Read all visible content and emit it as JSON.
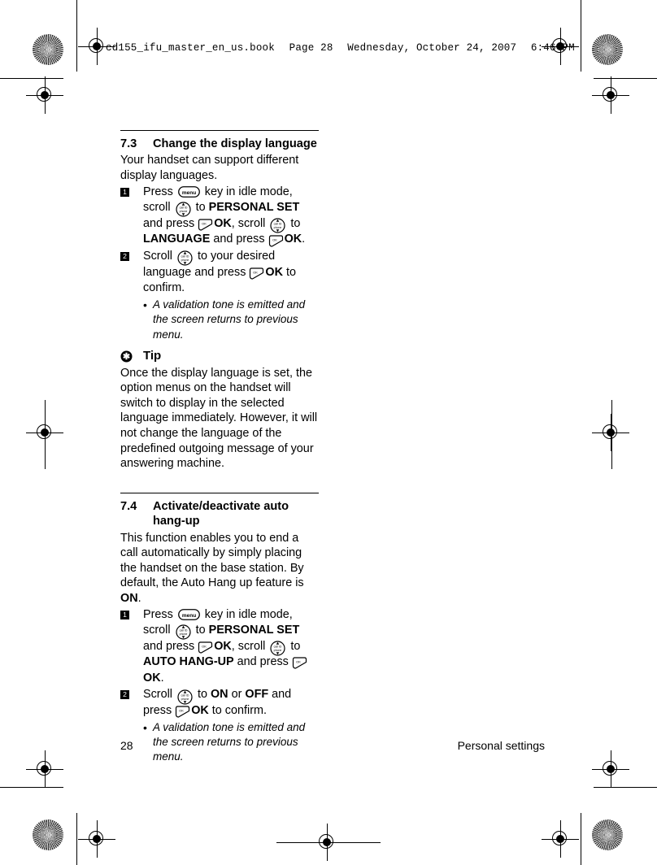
{
  "page": {
    "book_header": {
      "filename": "cd155_ifu_master_en_us.book",
      "page_label": "Page 28",
      "date": "Wednesday, October 24, 2007",
      "time": "6:46 PM"
    },
    "footer": {
      "page_number": "28",
      "chapter": "Personal settings"
    }
  },
  "sections": [
    {
      "number": "7.3",
      "title": "Change the display language",
      "intro": "Your handset can support different display languages.",
      "steps": [
        {
          "marker": "1",
          "parts": [
            {
              "type": "text",
              "value": "Press "
            },
            {
              "type": "key",
              "icon": "menu-key-icon",
              "label": "menu"
            },
            {
              "type": "text",
              "value": " key in idle mode, scroll "
            },
            {
              "type": "key",
              "icon": "scroll-key-icon",
              "label": "scroll"
            },
            {
              "type": "text",
              "value": " to "
            },
            {
              "type": "bold",
              "value": "PERSONAL SET"
            },
            {
              "type": "text",
              "value": " and press "
            },
            {
              "type": "key",
              "icon": "ok-softkey-icon",
              "label": "OK"
            },
            {
              "type": "bold",
              "value": "OK"
            },
            {
              "type": "text",
              "value": ", scroll "
            },
            {
              "type": "key",
              "icon": "scroll-key-icon",
              "label": "scroll"
            },
            {
              "type": "text",
              "value": " to "
            },
            {
              "type": "bold",
              "value": "LANGUAGE"
            },
            {
              "type": "text",
              "value": " and press "
            },
            {
              "type": "key",
              "icon": "ok-softkey-icon",
              "label": "OK"
            },
            {
              "type": "bold",
              "value": "OK"
            },
            {
              "type": "text",
              "value": "."
            }
          ]
        },
        {
          "marker": "2",
          "parts": [
            {
              "type": "text",
              "value": "Scroll "
            },
            {
              "type": "key",
              "icon": "scroll-key-icon",
              "label": "scroll"
            },
            {
              "type": "text",
              "value": " to your desired language and press "
            },
            {
              "type": "key",
              "icon": "ok-softkey-icon",
              "label": "OK"
            },
            {
              "type": "bold",
              "value": "OK"
            },
            {
              "type": "text",
              "value": " to confirm."
            }
          ],
          "note": "A validation tone is emitted and the screen returns to previous menu."
        }
      ],
      "tip": {
        "label": "Tip",
        "icon": "asterisk-tip-icon",
        "text": "Once the display language is set, the option menus on the handset will switch to display in the selected language immediately. However, it will not change the language of the predefined outgoing message of your answering machine."
      }
    },
    {
      "number": "7.4",
      "title": "Activate/deactivate auto hang-up",
      "intro_parts": [
        {
          "type": "text",
          "value": "This function enables you to end a call automatically by simply placing the handset on the base station. By default, the Auto Hang up feature is "
        },
        {
          "type": "bold",
          "value": "ON"
        },
        {
          "type": "text",
          "value": "."
        }
      ],
      "steps": [
        {
          "marker": "1",
          "parts": [
            {
              "type": "text",
              "value": "Press "
            },
            {
              "type": "key",
              "icon": "menu-key-icon",
              "label": "menu"
            },
            {
              "type": "text",
              "value": " key in idle mode, scroll "
            },
            {
              "type": "key",
              "icon": "scroll-key-icon",
              "label": "scroll"
            },
            {
              "type": "text",
              "value": " to "
            },
            {
              "type": "bold",
              "value": "PERSONAL SET"
            },
            {
              "type": "text",
              "value": " and press "
            },
            {
              "type": "key",
              "icon": "ok-softkey-icon",
              "label": "OK"
            },
            {
              "type": "bold",
              "value": "OK"
            },
            {
              "type": "text",
              "value": ", scroll "
            },
            {
              "type": "key",
              "icon": "scroll-key-icon",
              "label": "scroll"
            },
            {
              "type": "text",
              "value": " to "
            },
            {
              "type": "bold",
              "value": "AUTO HANG-UP"
            },
            {
              "type": "text",
              "value": " and press "
            },
            {
              "type": "key",
              "icon": "ok-softkey-icon",
              "label": "OK"
            },
            {
              "type": "bold",
              "value": "OK"
            },
            {
              "type": "text",
              "value": "."
            }
          ]
        },
        {
          "marker": "2",
          "parts": [
            {
              "type": "text",
              "value": "Scroll "
            },
            {
              "type": "key",
              "icon": "scroll-key-icon",
              "label": "scroll"
            },
            {
              "type": "text",
              "value": " to "
            },
            {
              "type": "bold",
              "value": "ON"
            },
            {
              "type": "text",
              "value": " or "
            },
            {
              "type": "bold",
              "value": "OFF"
            },
            {
              "type": "text",
              "value": " and press "
            },
            {
              "type": "key",
              "icon": "ok-softkey-icon",
              "label": "OK"
            },
            {
              "type": "bold",
              "value": "OK"
            },
            {
              "type": "text",
              "value": " to confirm."
            }
          ],
          "note": "A validation tone is emitted and the screen returns to previous menu."
        }
      ]
    }
  ],
  "key_icons": {
    "menu_label": "menu",
    "ok_label": "OK",
    "scroll_top_label": "call ID",
    "scroll_bottom_label": "phone"
  },
  "colors": {
    "ink": "#000000",
    "paper": "#ffffff"
  }
}
